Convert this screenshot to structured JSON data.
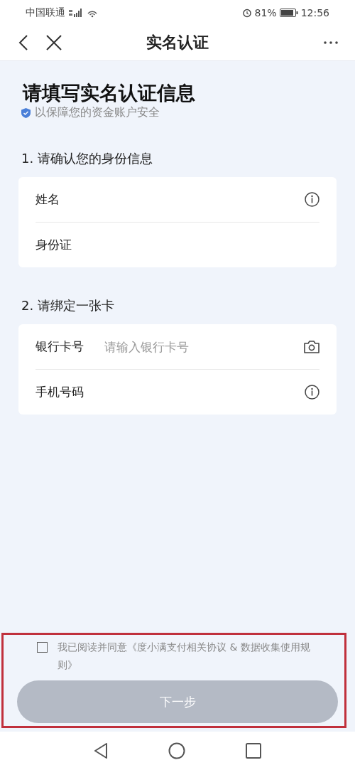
{
  "status_bar": {
    "carrier": "中国联通",
    "battery": "81%",
    "time": "12:56"
  },
  "nav": {
    "title": "实名认证"
  },
  "heading": {
    "title": "请填写实名认证信息",
    "subtitle": "以保障您的资金账户安全"
  },
  "sections": [
    {
      "title": "1. 请确认您的身份信息",
      "fields": [
        {
          "label": "姓名",
          "kind": "info"
        },
        {
          "label": "身份证",
          "kind": "plain"
        }
      ]
    },
    {
      "title": "2. 请绑定一张卡",
      "fields": [
        {
          "label": "银行卡号",
          "placeholder": "请输入银行卡号",
          "kind": "camera"
        },
        {
          "label": "手机号码",
          "kind": "info"
        }
      ]
    }
  ],
  "agreement": {
    "checked": false,
    "text": "我已阅读并同意《度小满支付相关协议 & 数据收集使用规则》"
  },
  "next_button": {
    "label": "下一步",
    "disabled": true
  },
  "annotation": {
    "kind": "highlight-box"
  }
}
